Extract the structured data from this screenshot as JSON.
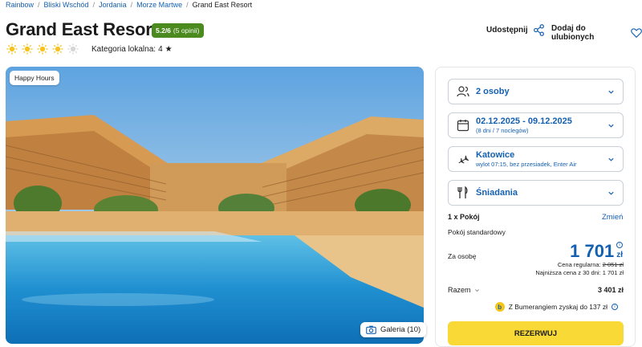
{
  "breadcrumb": {
    "items": [
      "Rainbow",
      "Bliski Wschód",
      "Jordania",
      "Morze Martwe"
    ],
    "separator": "/",
    "current": "Grand East Resort"
  },
  "hotel": {
    "name": "Grand East Resort",
    "rating_score": "5.2/6",
    "rating_count": "(5 opinii)",
    "stars_filled": 4,
    "stars_total": 5,
    "category_label": "Kategoria lokalna:",
    "category_value": "4"
  },
  "actions": {
    "share_label": "Udostępnij",
    "favorite_label": "Dodaj do ulubionych"
  },
  "gallery": {
    "badge": "Happy Hours",
    "button_label": "Galeria (10)"
  },
  "booking": {
    "guests": "2 osoby",
    "dates": "02.12.2025 - 09.12.2025",
    "dates_sub": "(8 dni / 7 noclegów)",
    "departure": "Katowice",
    "departure_sub": "wylot 07:15, bez przesiadek, Enter Air",
    "board": "Śniadania",
    "room_count": "1 x Pokój",
    "change_label": "Zmień",
    "room_type": "Pokój standardowy",
    "per_person_label": "Za osobę",
    "price": "1 701",
    "currency": "zł",
    "regular_label": "Cena regularna:",
    "regular_price": "2 051 zł",
    "lowest_30": "Najniższa cena z 30 dni: 1 701 zł",
    "total_label": "Razem",
    "total_value": "3 401 zł",
    "bumerang": "Z Bumerangiem zyskaj do 137 zł",
    "book_label": "REZERWUJ"
  },
  "colors": {
    "accent": "#1460b0",
    "rating_green": "#4a8a1e",
    "cta_yellow": "#f9d936",
    "sun_yellow": "#f7c21c"
  },
  "icons": [
    "share-icon",
    "heart-icon",
    "sun-icon",
    "star-icon",
    "camera-icon",
    "users-icon",
    "calendar-icon",
    "plane-icon",
    "cutlery-icon",
    "chevron-down-icon",
    "info-icon"
  ]
}
